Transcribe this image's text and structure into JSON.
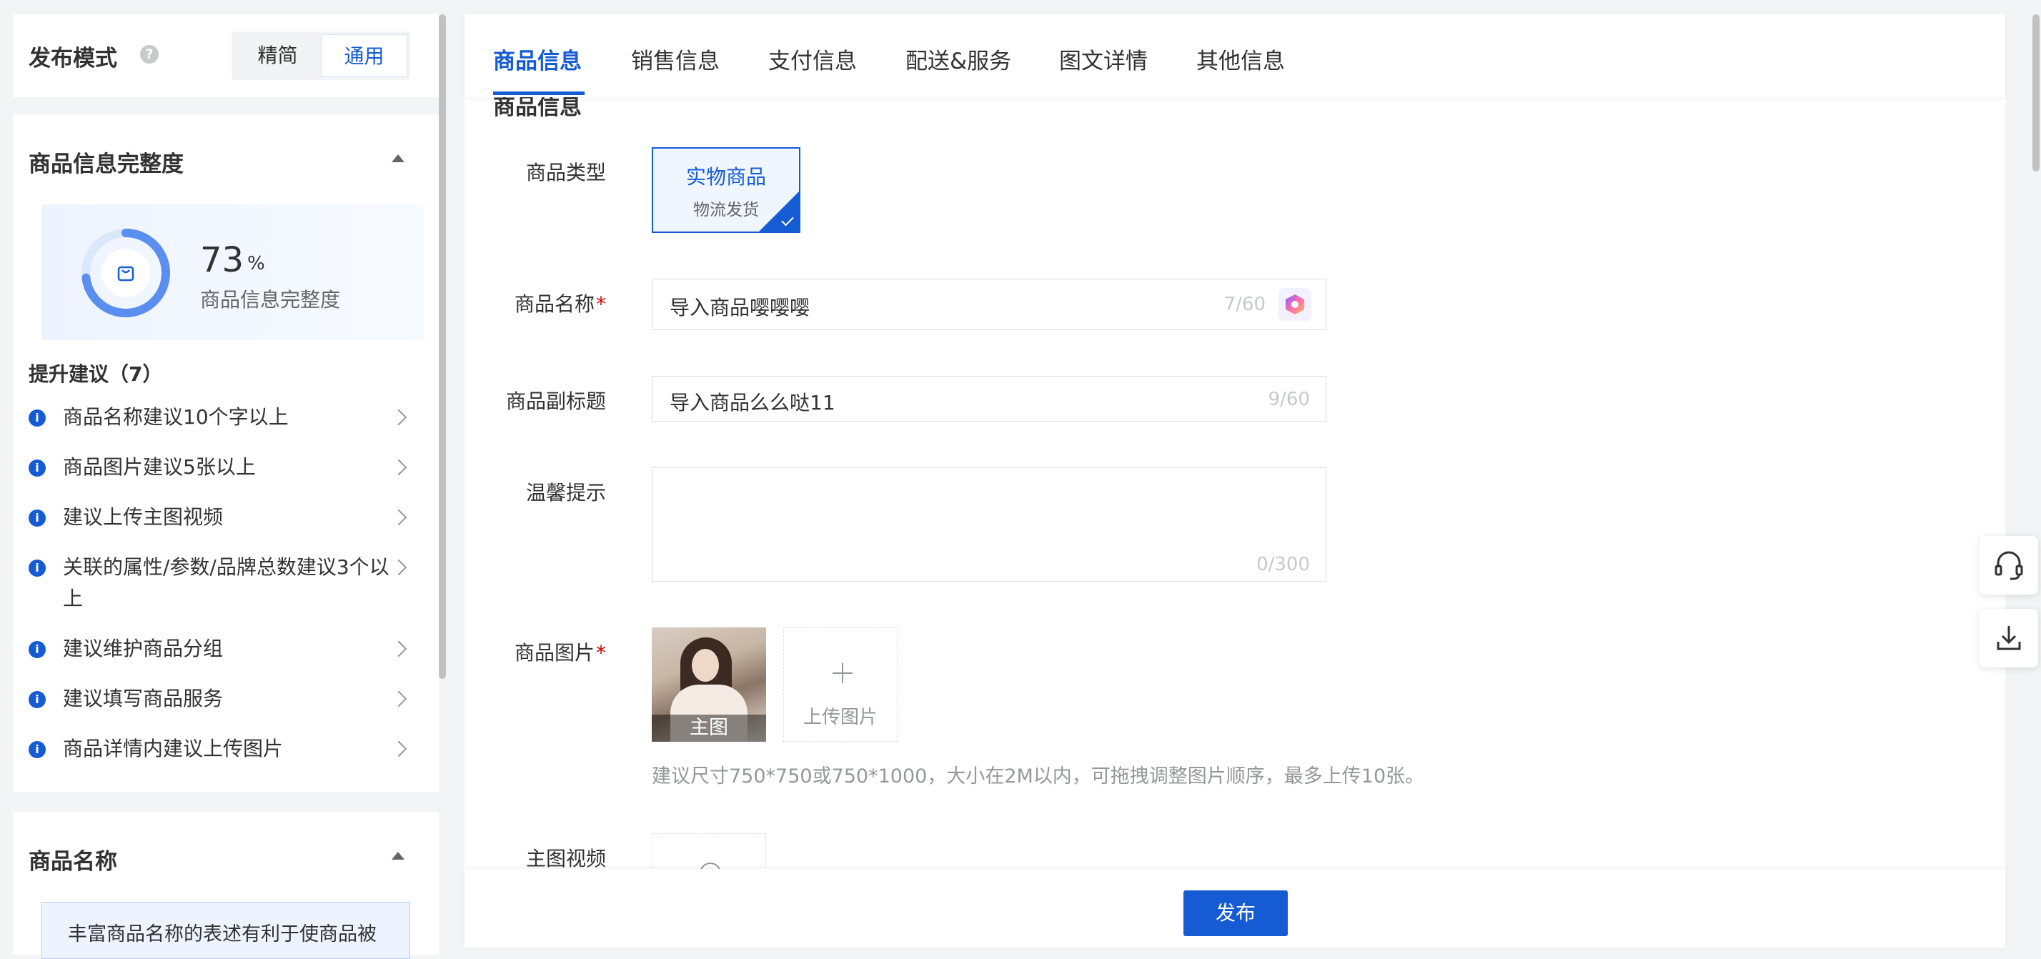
{
  "left": {
    "mode": {
      "title": "发布模式",
      "help": "?",
      "options": [
        "精简",
        "通用"
      ],
      "selected": "通用"
    },
    "completeness": {
      "title": "商品信息完整度",
      "percent": 73,
      "percent_unit": "%",
      "label": "商品信息完整度",
      "suggestions_title": "提升建议（7）",
      "suggestions": [
        "商品名称建议10个字以上",
        "商品图片建议5张以上",
        "建议上传主图视频",
        "关联的属性/参数/品牌总数建议3个以上",
        "建议维护商品分组",
        "建议填写商品服务",
        "商品详情内建议上传图片"
      ]
    },
    "name_section": {
      "title": "商品名称",
      "tip": "丰富商品名称的表述有利于使商品被"
    }
  },
  "tabs": [
    "商品信息",
    "销售信息",
    "支付信息",
    "配送&服务",
    "图文详情",
    "其他信息"
  ],
  "active_tab": "商品信息",
  "form": {
    "section_title": "商品信息",
    "type": {
      "label": "商品类型",
      "option_title": "实物商品",
      "option_sub": "物流发货"
    },
    "name": {
      "label": "商品名称",
      "required": "*",
      "value": "导入商品嘤嘤嘤",
      "count": "7/60"
    },
    "subtitle": {
      "label": "商品副标题",
      "value": "导入商品么么哒11",
      "count": "9/60"
    },
    "tip": {
      "label": "温馨提示",
      "value": "",
      "count": "0/300"
    },
    "images": {
      "label": "商品图片",
      "required": "*",
      "main_caption": "主图",
      "upload_label": "上传图片",
      "hint": "建议尺寸750*750或750*1000，大小在2M以内，可拖拽调整图片顺序，最多上传10张。"
    },
    "video": {
      "label": "主图视频"
    }
  },
  "footer": {
    "publish": "发布"
  },
  "colors": {
    "primary": "#155bd4",
    "required": "#d40000",
    "muted": "#969799"
  },
  "icons": [
    "help-icon",
    "caret-up-icon",
    "info-icon",
    "chevron-right-icon",
    "ai-icon",
    "plus-icon",
    "headset-icon",
    "download-icon"
  ]
}
